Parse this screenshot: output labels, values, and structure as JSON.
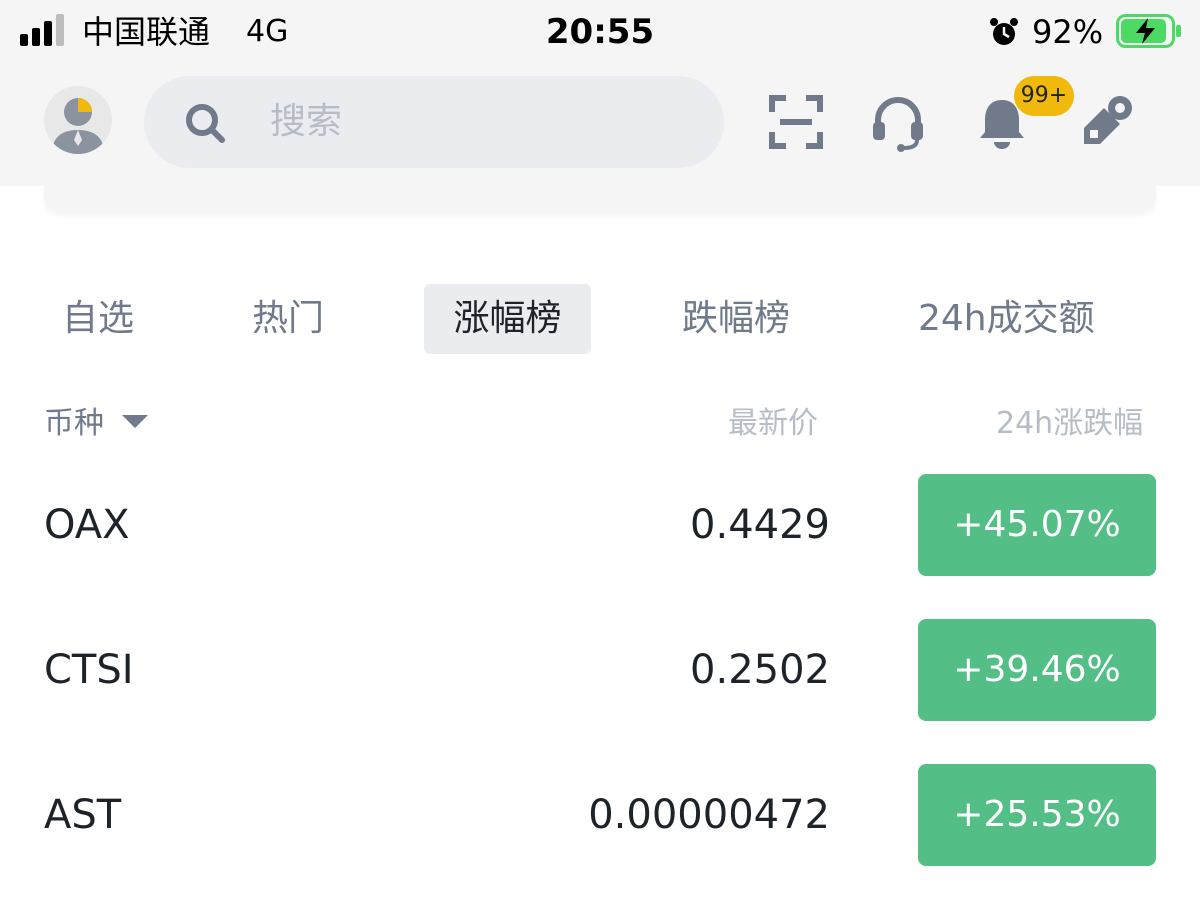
{
  "status_bar": {
    "carrier": "中国联通",
    "network": "4G",
    "time": "20:55",
    "battery": "92%"
  },
  "header": {
    "search_placeholder": "搜索",
    "notification_badge": "99+",
    "icons": [
      "avatar-icon",
      "search-icon",
      "scan-icon",
      "headset-icon",
      "bell-icon",
      "rewards-icon"
    ]
  },
  "tabs": [
    {
      "label": "自选"
    },
    {
      "label": "热门"
    },
    {
      "label": "涨幅榜",
      "active": true
    },
    {
      "label": "跌幅榜"
    },
    {
      "label": "24h成交额"
    }
  ],
  "columns": {
    "coin": "币种",
    "last_price": "最新价",
    "change_24h": "24h涨跌幅"
  },
  "rows": [
    {
      "symbol": "OAX",
      "price": "0.4429",
      "change": "+45.07%"
    },
    {
      "symbol": "CTSI",
      "price": "0.2502",
      "change": "+39.46%"
    },
    {
      "symbol": "AST",
      "price": "0.00000472",
      "change": "+25.53%"
    }
  ],
  "colors": {
    "accent": "#f0b90b",
    "positive": "#53be86",
    "text_primary": "#1e2329",
    "text_secondary": "#707a8a",
    "text_muted": "#b7bdc6"
  }
}
